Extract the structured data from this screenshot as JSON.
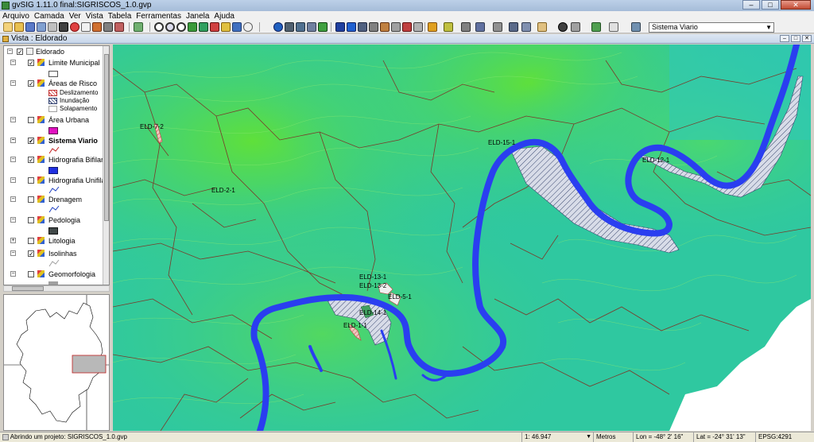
{
  "window": {
    "title": "gvSIG 1.11.0 final:SIGRISCOS_1.0.gvp"
  },
  "menu": [
    "Arquivo",
    "Camada",
    "Ver",
    "Vista",
    "Tabela",
    "Ferramentas",
    "Janela",
    "Ajuda"
  ],
  "toolbar": {
    "layer_select_value": "Sistema Viario"
  },
  "view": {
    "title": "Vista : Eldorado"
  },
  "toc": {
    "root": "Eldorado",
    "layers": [
      {
        "name": "Limite Municipal",
        "checked": true,
        "legend": [
          "box-white"
        ]
      },
      {
        "name": "Áreas de Risco",
        "checked": true,
        "legend_items": [
          "Deslizamento",
          "Inundação",
          "Solapamento"
        ]
      },
      {
        "name": "Área Urbana",
        "checked": false,
        "legend": [
          "box-magenta"
        ]
      },
      {
        "name": "Sistema Viario",
        "checked": true,
        "bold": true,
        "legend": [
          "line-red"
        ]
      },
      {
        "name": "Hidrografia Bifilar",
        "checked": true,
        "legend": [
          "box-blue"
        ]
      },
      {
        "name": "Hidrografia Unifilar",
        "checked": false,
        "legend": [
          "line-blue"
        ]
      },
      {
        "name": "Drenagem",
        "checked": false,
        "legend": [
          "line-blue"
        ]
      },
      {
        "name": "Pedologia",
        "checked": false,
        "legend": [
          "box-dark"
        ]
      },
      {
        "name": "Litologia",
        "checked": false
      },
      {
        "name": "Isolinhas",
        "checked": true,
        "legend": [
          "line-gray"
        ]
      },
      {
        "name": "Geomorfologia",
        "checked": false,
        "legend": [
          "box-gray"
        ]
      }
    ]
  },
  "map_labels": [
    "ELD-7-2",
    "ELD-2-1",
    "ELD-15-1",
    "ELD-12-1",
    "ELD-13-1",
    "ELD-13-2",
    "ELD-5-1",
    "ELD-14-1",
    "ELD-1-1"
  ],
  "status": {
    "message": "Abrindo um projeto: SIGRISCOS_1.0.gvp",
    "scale_prefix": "1:",
    "scale_value": "46.947",
    "units": "Metros",
    "lon": "Lon = -48° 2' 16\"",
    "lat": "Lat = -24° 31' 13\"",
    "epsg": "EPSG:4291"
  },
  "colors": {
    "terrain": "#2fc8a0",
    "terrain_high": "#5fe03a",
    "river": "#2a3ef0",
    "roads": "#7a3a2a",
    "risk_fill": "#c8d0e0"
  }
}
